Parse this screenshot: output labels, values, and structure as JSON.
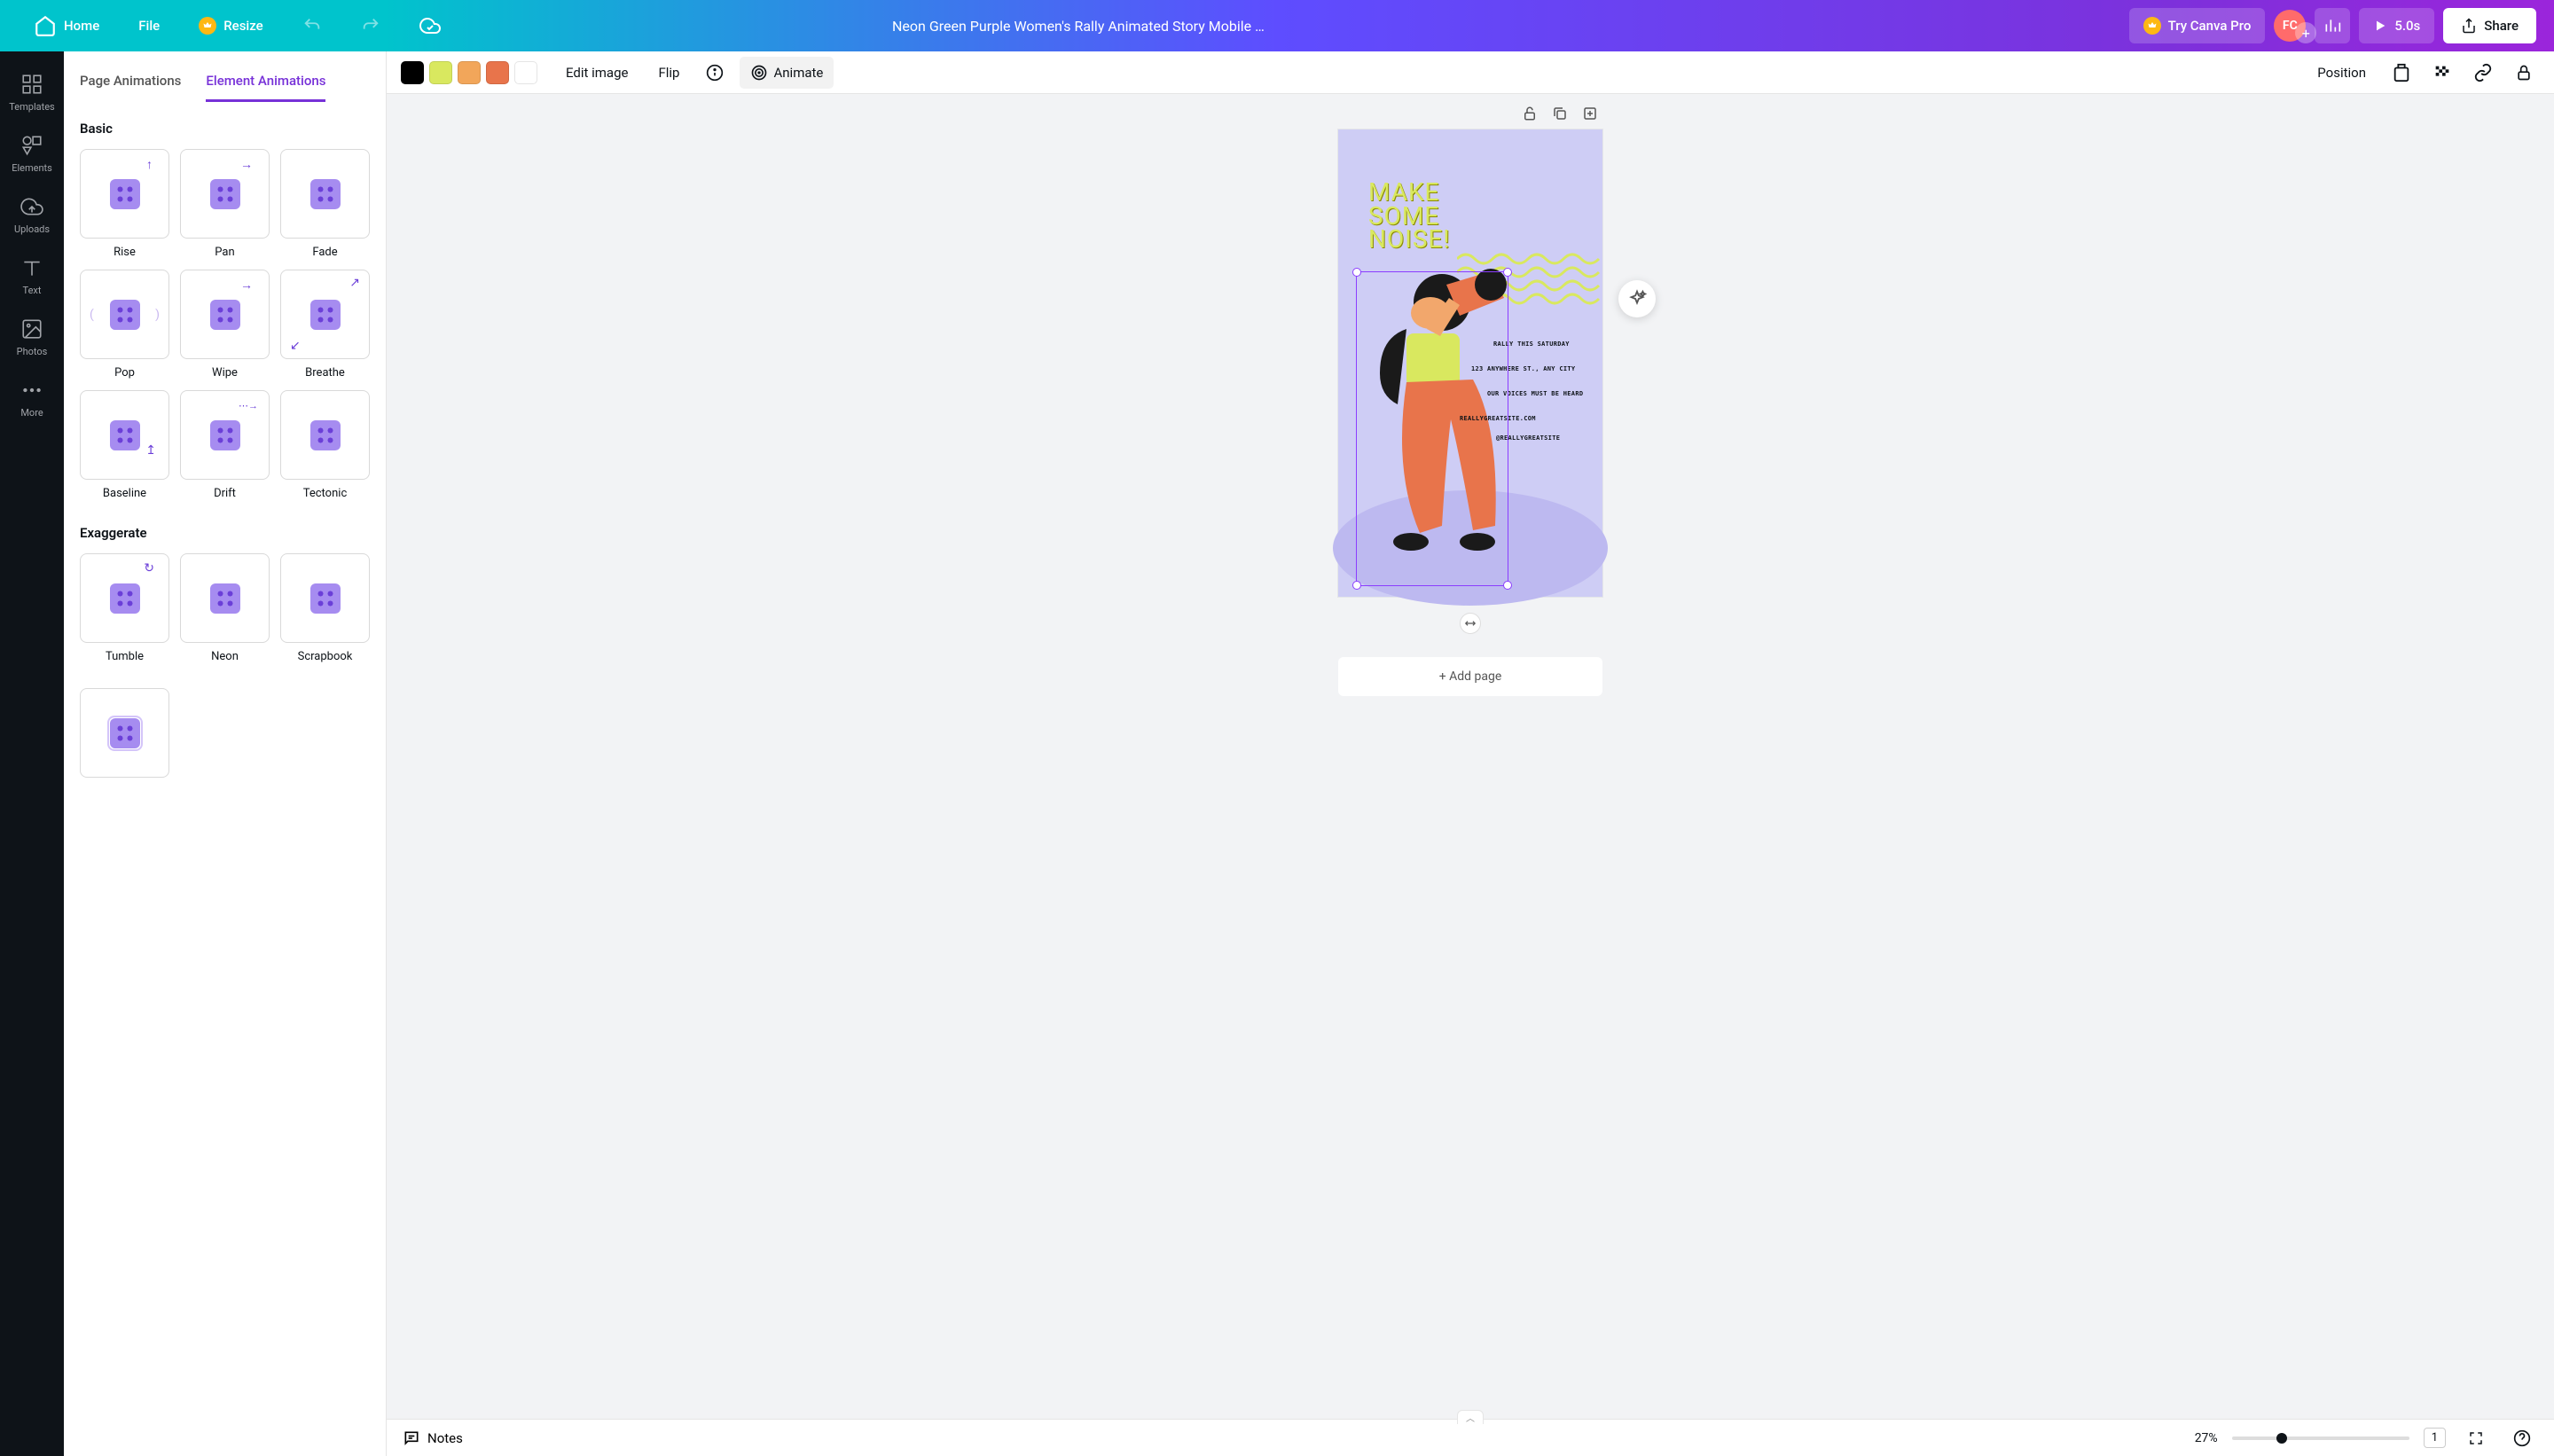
{
  "header": {
    "home": "Home",
    "file": "File",
    "resize": "Resize",
    "title": "Neon Green Purple Women's Rally Animated Story Mobile V...",
    "try_pro": "Try Canva Pro",
    "avatar_initials": "FC",
    "duration": "5.0s",
    "share": "Share"
  },
  "rail": {
    "templates": "Templates",
    "elements": "Elements",
    "uploads": "Uploads",
    "text": "Text",
    "photos": "Photos",
    "more": "More"
  },
  "panel": {
    "tab_page": "Page Animations",
    "tab_element": "Element Animations",
    "section_basic": "Basic",
    "section_ex": "Exaggerate",
    "basic": [
      "Rise",
      "Pan",
      "Fade",
      "Pop",
      "Wipe",
      "Breathe",
      "Baseline",
      "Drift",
      "Tectonic"
    ],
    "ex": [
      "Tumble",
      "Neon",
      "Scrapbook"
    ]
  },
  "toolbar": {
    "swatches": [
      "#000000",
      "#D9E85F",
      "#F2A65A",
      "#E8744B",
      "#FFFFFF"
    ],
    "edit_image": "Edit image",
    "flip": "Flip",
    "animate": "Animate",
    "position": "Position"
  },
  "canvas": {
    "headline1": "MAKE",
    "headline2": "SOME",
    "headline3": "NOISE!",
    "t1": "RALLY THIS SATURDAY",
    "t2": "123 ANYWHERE ST., ANY CITY",
    "t3": "OUR VOICES MUST BE HEARD",
    "t4": "REALLYGREATSITE.COM",
    "t5": "@REALLYGREATSITE",
    "add_page": "+ Add page"
  },
  "footer": {
    "notes": "Notes",
    "zoom": "27%",
    "page_count": "1"
  }
}
